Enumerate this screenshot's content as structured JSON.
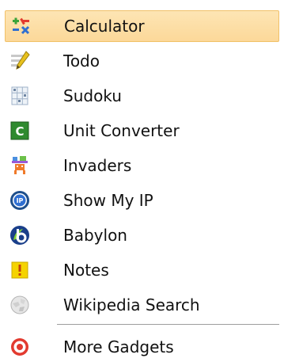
{
  "menu": {
    "items": [
      {
        "label": "Calculator",
        "icon": "calculator-icon"
      },
      {
        "label": "Todo",
        "icon": "todo-icon"
      },
      {
        "label": "Sudoku",
        "icon": "sudoku-icon"
      },
      {
        "label": "Unit Converter",
        "icon": "unit-converter-icon"
      },
      {
        "label": "Invaders",
        "icon": "invaders-icon"
      },
      {
        "label": "Show My IP",
        "icon": "show-my-ip-icon"
      },
      {
        "label": "Babylon",
        "icon": "babylon-icon"
      },
      {
        "label": "Notes",
        "icon": "notes-icon"
      },
      {
        "label": "Wikipedia Search",
        "icon": "wikipedia-icon"
      },
      {
        "label": "More Gadgets",
        "icon": "more-gadgets-icon"
      }
    ],
    "highlighted_index": 0,
    "highlight_color": "#fcd899"
  }
}
